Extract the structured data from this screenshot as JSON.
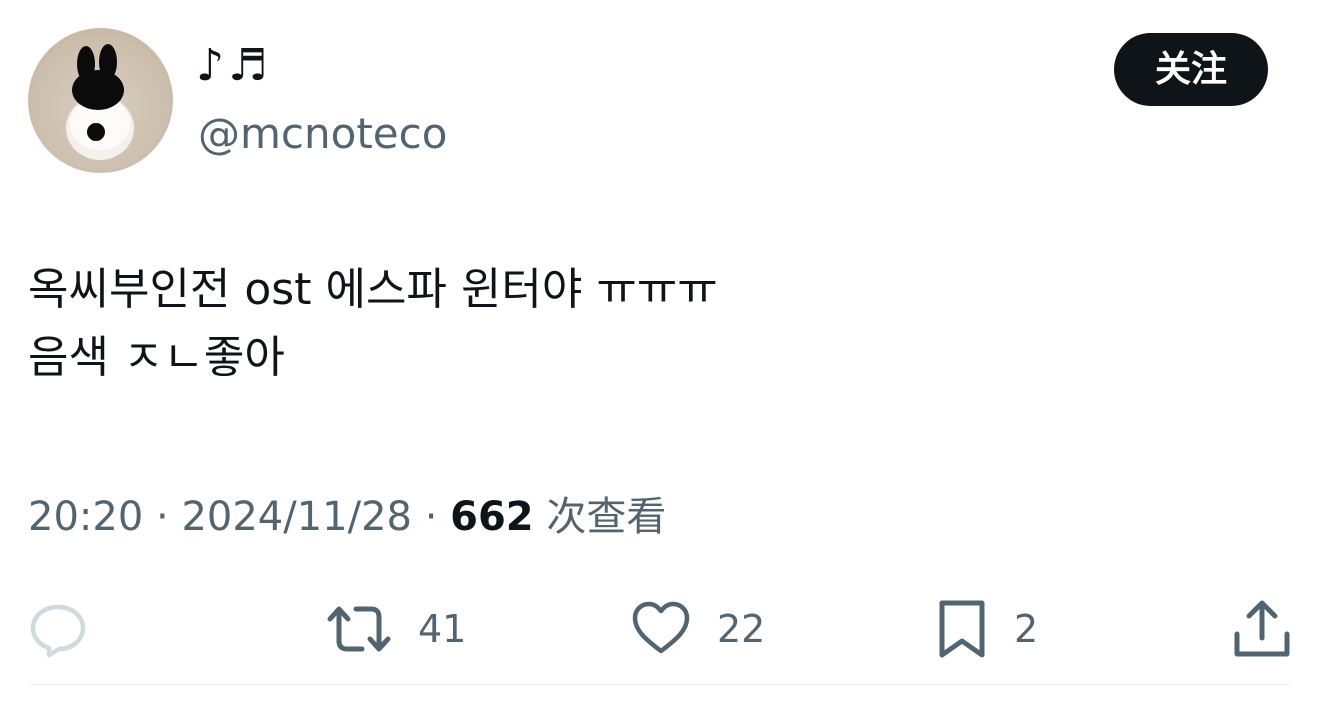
{
  "user": {
    "display_name": "♪♬",
    "handle": "@mcnoteco",
    "avatar_icon": "bunny-plush-avatar"
  },
  "follow_button": {
    "label": "关注"
  },
  "tweet": {
    "line1": "옥씨부인전 ost 에스파 윈터야 ㅠㅠㅠ",
    "line2": "음색 ㅈㄴ좋아"
  },
  "meta": {
    "time": "20:20",
    "date": "2024/11/28",
    "separator": "·",
    "views_count": "662",
    "views_label": "次查看"
  },
  "actions": {
    "reply": {
      "icon": "reply-icon"
    },
    "retweet": {
      "icon": "retweet-icon",
      "count": "41"
    },
    "like": {
      "icon": "heart-icon",
      "count": "22"
    },
    "bookmark": {
      "icon": "bookmark-icon",
      "count": "2"
    },
    "share": {
      "icon": "share-icon"
    }
  },
  "colors": {
    "text_primary": "#0f1419",
    "text_secondary": "#536471",
    "button_bg": "#0f1419",
    "reply_icon_disabled": "#cfd9de"
  }
}
